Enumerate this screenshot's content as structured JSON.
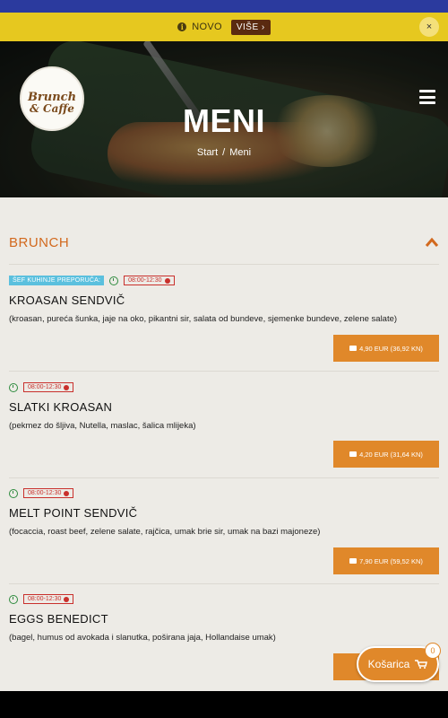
{
  "notice": {
    "text": "NOVO",
    "more_label": "VIŠE ›",
    "close_label": "×"
  },
  "logo": {
    "line1": "Brunch",
    "line2": "& Caffe"
  },
  "hero": {
    "title": "MENI"
  },
  "breadcrumb": {
    "home": "Start",
    "separator": "/",
    "current": "Meni"
  },
  "section": {
    "title": "BRUNCH"
  },
  "items": [
    {
      "chef_tag": "ŠEF KUHINJE PREPORUČA:",
      "time": "08:00-12:30",
      "name": "KROASAN SENDVIČ",
      "desc": "(kroasan, pureća šunka, jaje na oko, pikantni sir, salata od bundeve, sjemenke bundeve, zelene salate)",
      "price": "4,90 EUR (36,92 KN)"
    },
    {
      "time": "08:00-12:30",
      "name": "SLATKI KROASAN",
      "desc": "(pekmez do šljiva, Nutella, maslac, šalica mlijeka)",
      "price": "4,20 EUR (31,64 KN)"
    },
    {
      "time": "08:00-12:30",
      "name": "MELT POINT SENDVIČ",
      "desc": "(focaccia, roast beef, zelene salate, rajčica, umak brie sir, umak na bazi majoneze)",
      "price": "7,90 EUR (59,52 KN)"
    },
    {
      "time": "08:00-12:30",
      "name": "EGGS BENEDICT",
      "desc": "(bagel, humus od avokada i slanutka, poširana jaja, Hollandaise umak)",
      "price": ""
    }
  ],
  "cart": {
    "label": "Košarica",
    "count": "0"
  },
  "colors": {
    "accent": "#e0882a",
    "section_title": "#d2691e",
    "notice_bg": "#e6c81f",
    "chef_tag": "#5bc0de",
    "time_tag": "#c9302c",
    "clock": "#2e8b3e"
  }
}
